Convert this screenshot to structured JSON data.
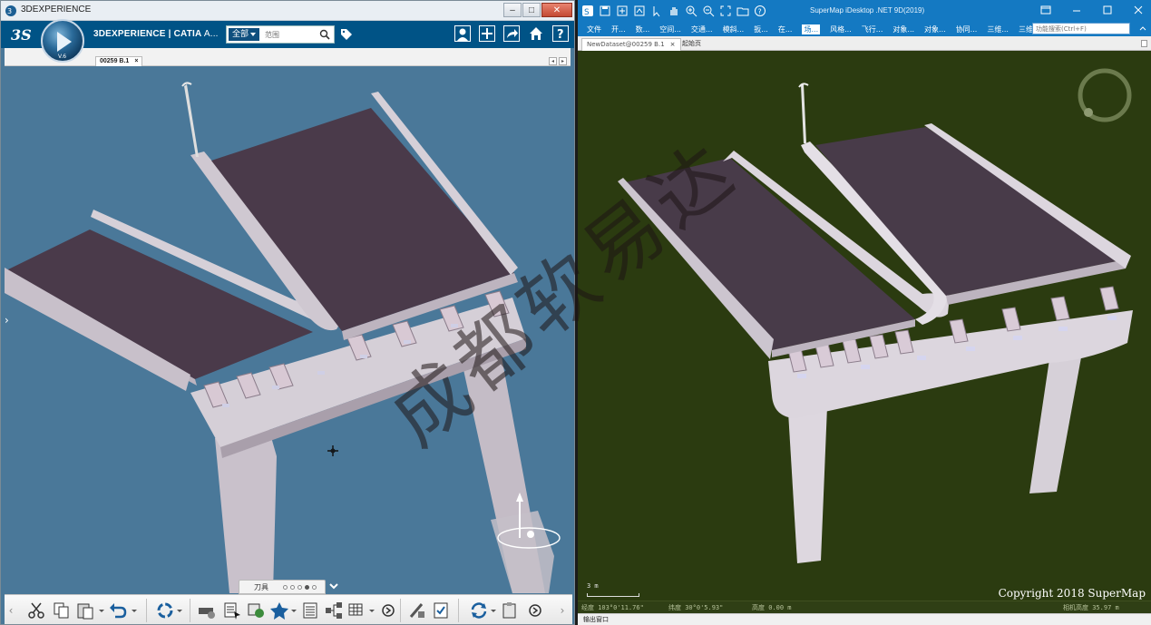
{
  "left_window": {
    "title": "3DEXPERIENCE",
    "controls": {
      "minimize": "–",
      "maximize": "□",
      "close": "✕"
    },
    "brand_bold": "3DEXPERIENCE | CATIA",
    "brand_thin": " A...",
    "compass_version": "V.6",
    "search": {
      "scope": "全部",
      "placeholder": "范围"
    },
    "tab": {
      "label": "00259 B.1",
      "close": "×"
    },
    "tab_nav": [
      "◂",
      "▸"
    ],
    "side_arrow": "›",
    "pager": {
      "label": "刀具",
      "dots": 5,
      "active_dot": 4
    },
    "toolbar_edges": {
      "left": "‹",
      "right": "›"
    },
    "icons": [
      "ds-logo",
      "me-icon",
      "add-icon",
      "share-icon",
      "home-icon",
      "help-icon",
      "tag-icon"
    ]
  },
  "right_window": {
    "title": "SuperMap iDesktop .NET 9D(2019)",
    "menu": [
      "文件",
      "开...",
      "数...",
      "空间...",
      "交通...",
      "模斜...",
      "扳...",
      "在...",
      "场...",
      "风格...",
      "飞行...",
      "对象...",
      "对象...",
      "协同...",
      "三维...",
      "三维..."
    ],
    "active_menu_index": 8,
    "function_search_placeholder": "功能搜索(Ctrl+F)",
    "tabs": [
      {
        "label": "NewDataset@00259 B.1",
        "close": "×"
      },
      {
        "label": "起始页"
      }
    ],
    "scale_label": "3 m",
    "copyright": "Copyright 2018 SuperMap",
    "status": {
      "longitude": "经度 103°0'11.76\"",
      "latitude": "纬度 30°0'5.93\"",
      "altitude": "高度 0.00 m",
      "camera_height": "相机高度 35.97 m"
    },
    "output_window": "输出窗口"
  },
  "watermark": [
    "成",
    "都",
    "软",
    "易",
    "达"
  ],
  "colors": {
    "dx_header": "#005386",
    "dx_viewport": "#4a7899",
    "sm_titlebar": "#1479c2",
    "sm_viewport": "#2b3b10",
    "deck_surface": "#4a3a4a",
    "structure": "#d9d3db"
  }
}
